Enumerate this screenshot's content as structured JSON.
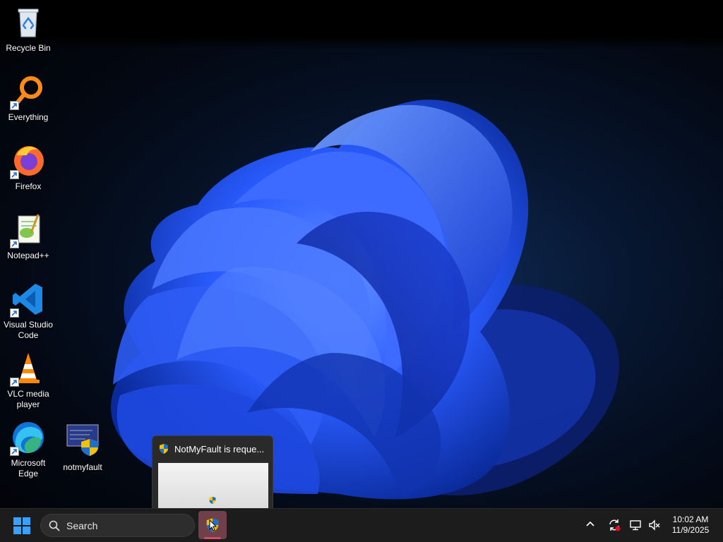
{
  "desktop": {
    "icons": [
      {
        "label": "Recycle Bin"
      },
      {
        "label": "Everything"
      },
      {
        "label": "Firefox"
      },
      {
        "label": "Notepad++"
      },
      {
        "label": "Visual Studio Code"
      },
      {
        "label": "VLC media player"
      },
      {
        "label": "Microsoft Edge"
      },
      {
        "label": "notmyfault"
      }
    ]
  },
  "taskbar": {
    "search_placeholder": "Search",
    "start_icon": "windows-logo",
    "running_app": {
      "name": "NotMyFault",
      "icon": "uac-shield-icon"
    },
    "thumbnail": {
      "title": "NotMyFault is reque..."
    },
    "tray": {
      "chevron_icon": "chevron-up-icon",
      "icons": [
        "sync-icon",
        "network-icon",
        "volume-muted-icon"
      ],
      "time": "10:02 AM",
      "date": "11/9/2025"
    }
  },
  "colors": {
    "taskbar_bg": "#1c1c1c",
    "accent_pink": "#d14b63",
    "bloom_blue": "#2a5cff",
    "windows_blue": "#3aa0ff"
  }
}
